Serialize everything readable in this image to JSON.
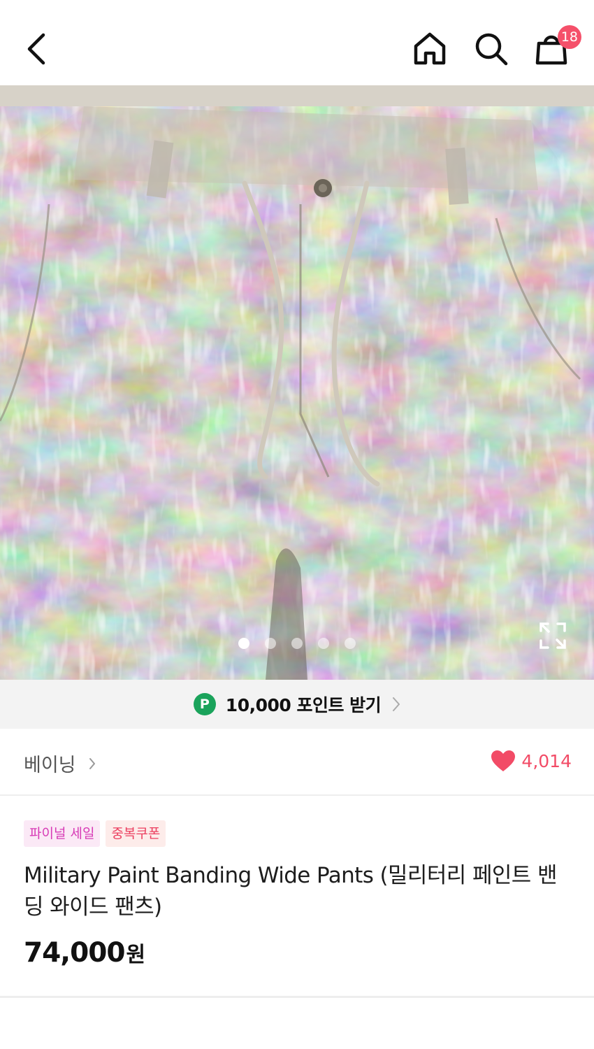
{
  "header": {
    "back_icon": "chevron-left-icon",
    "home_icon": "home-icon",
    "search_icon": "search-icon",
    "cart_icon": "shopping-bag-icon",
    "cart_count": "18"
  },
  "gallery": {
    "image_description": "camouflage paint-splatter wide pants",
    "total_images": 5,
    "active_index": 0,
    "expand_icon": "expand-icon"
  },
  "points": {
    "badge": "P",
    "text": "10,000 포인트 받기",
    "badge_color": "#1aa35b"
  },
  "brand": {
    "name": "베이닝",
    "like_count": "4,014",
    "like_color": "#f24b66"
  },
  "product": {
    "tags": [
      "파이널 세일",
      "중복쿠폰"
    ],
    "title": "Military Paint Banding Wide Pants (밀리터리 페인트 밴딩 와이드 팬츠)",
    "price": "74,000",
    "price_unit": "원"
  }
}
